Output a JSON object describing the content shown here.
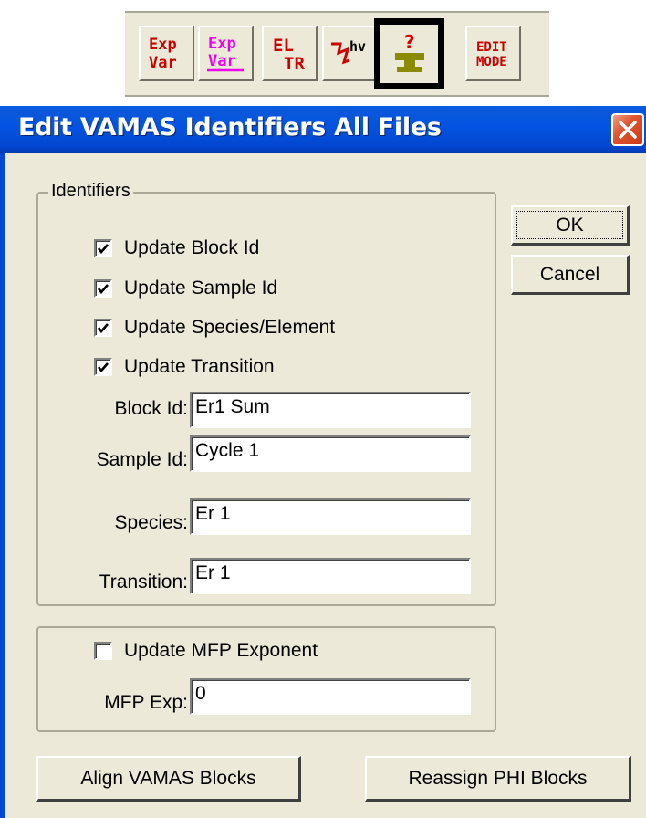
{
  "toolbar": {
    "buttons": [
      {
        "name": "exp-var-button",
        "label_top": "Exp",
        "label_bottom": "Var",
        "color": "#cc0000"
      },
      {
        "name": "exp-var-underline-button",
        "label_top": "Exp",
        "label_bottom": "Var",
        "color": "#ee00ee"
      },
      {
        "name": "el-tr-button",
        "label_top": "EL",
        "label_bottom": "TR",
        "color": "#cc0000"
      },
      {
        "name": "hv-button",
        "label_top": "hv",
        "color": "#cc0000"
      },
      {
        "name": "anvil-help-button",
        "icon": "anvil-question-icon",
        "color": "#8b8b00"
      },
      {
        "name": "edit-mode-button",
        "label_top": "EDIT",
        "label_bottom": "MODE",
        "color": "#cc0000"
      }
    ],
    "active_index": 4
  },
  "dialog": {
    "title": "Edit VAMAS  Identifiers All Files",
    "identifiers_group_label": "Identifiers",
    "checkboxes": [
      {
        "label": "Update Block Id",
        "checked": true
      },
      {
        "label": "Update Sample Id",
        "checked": true
      },
      {
        "label": "Update Species/Element",
        "checked": true
      },
      {
        "label": "Update Transition",
        "checked": true
      }
    ],
    "fields": [
      {
        "label": "Block Id:",
        "value": "Er1 Sum"
      },
      {
        "label": "Sample Id:",
        "value": "Cycle 1"
      },
      {
        "label": "Species:",
        "value": "Er 1"
      },
      {
        "label": "Transition:",
        "value": "Er 1"
      }
    ],
    "mfp": {
      "checkbox_label": "Update MFP Exponent",
      "checked": false,
      "field_label": "MFP Exp:",
      "field_value": "0"
    },
    "buttons": {
      "ok": "OK",
      "cancel": "Cancel",
      "align": "Align VAMAS Blocks",
      "reassign": "Reassign PHI Blocks"
    }
  }
}
